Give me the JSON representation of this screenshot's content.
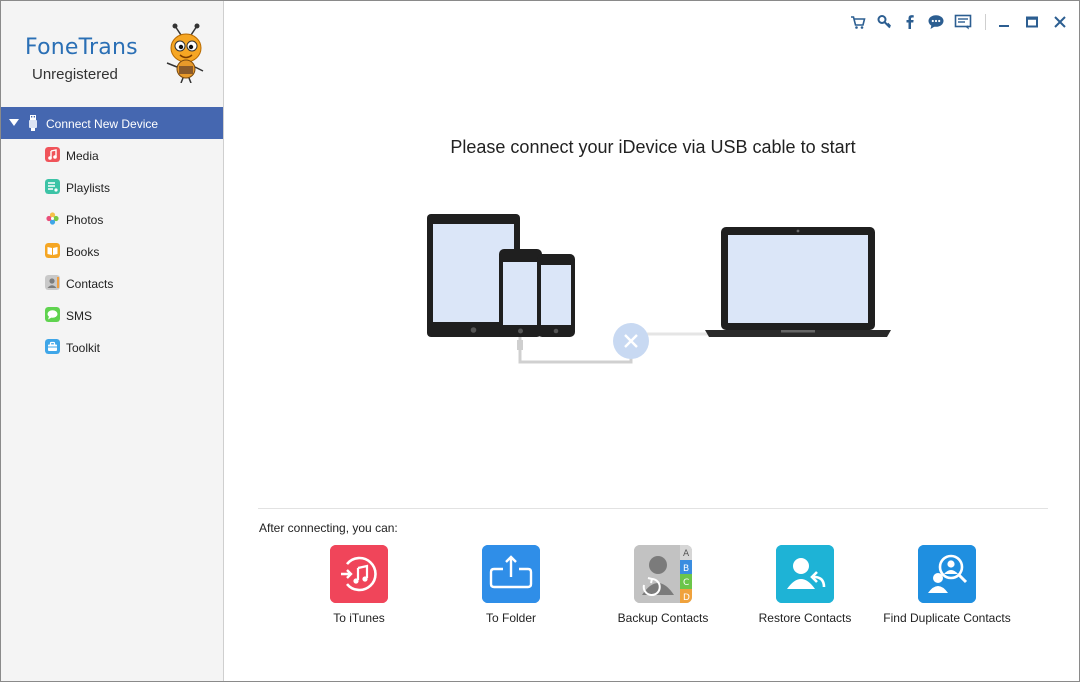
{
  "brand": {
    "name": "FoneTrans",
    "status": "Unregistered"
  },
  "device": {
    "label": "Connect New Device"
  },
  "sidebar": {
    "items": [
      {
        "label": "Media",
        "icon": "media-icon",
        "color": "#f0545a"
      },
      {
        "label": "Playlists",
        "icon": "playlists-icon",
        "color": "#3cc3a6"
      },
      {
        "label": "Photos",
        "icon": "photos-icon",
        "color": "#f3a33c"
      },
      {
        "label": "Books",
        "icon": "books-icon",
        "color": "#f5a623"
      },
      {
        "label": "Contacts",
        "icon": "contacts-icon",
        "color": "#b8b8b8"
      },
      {
        "label": "SMS",
        "icon": "sms-icon",
        "color": "#5fd34f"
      },
      {
        "label": "Toolkit",
        "icon": "toolkit-icon",
        "color": "#3fa6e8"
      }
    ]
  },
  "titlebar": {
    "icons": [
      "cart-icon",
      "key-icon",
      "facebook-icon",
      "chat-icon",
      "feedback-icon",
      "minimize-icon",
      "maximize-icon",
      "close-icon"
    ]
  },
  "main": {
    "headline": "Please connect your iDevice via USB cable to start",
    "after_label": "After connecting, you can:",
    "actions": [
      {
        "label": "To iTunes",
        "color": "#f0455a"
      },
      {
        "label": "To Folder",
        "color": "#2f8ee8"
      },
      {
        "label": "Backup Contacts",
        "color": "#bdbdbd"
      },
      {
        "label": "Restore Contacts",
        "color": "#1eb3d6"
      },
      {
        "label": "Find Duplicate Contacts",
        "color": "#1f8fe0"
      }
    ]
  },
  "colors": {
    "accent": "#4567b0",
    "brand": "#2a6fb5",
    "disconnected": "#c8d9f2"
  }
}
